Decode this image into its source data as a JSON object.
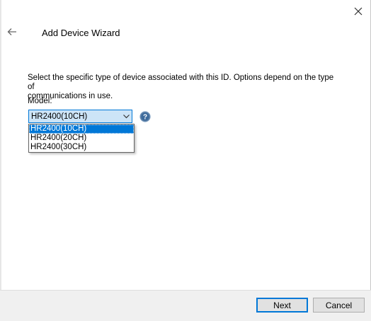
{
  "window": {
    "title": "Add Device Wizard",
    "close_icon": "close-icon",
    "back_icon": "back-arrow-icon"
  },
  "content": {
    "description_line1": "Select the specific type of device associated with this ID. Options depend on the type of",
    "description_line2": "communications in use.",
    "model_label": "Model:",
    "model_selected": "HR2400(10CH)",
    "model_options": [
      "HR2400(10CH)",
      "HR2400(20CH)",
      "HR2400(30CH)"
    ],
    "help_icon": "help-icon"
  },
  "footer": {
    "next_label": "Next",
    "cancel_label": "Cancel"
  },
  "colors": {
    "accent": "#0078d7",
    "selection_bg": "#cce4f7",
    "footer_bg": "#f0f0f0",
    "button_bg": "#e1e1e1"
  }
}
